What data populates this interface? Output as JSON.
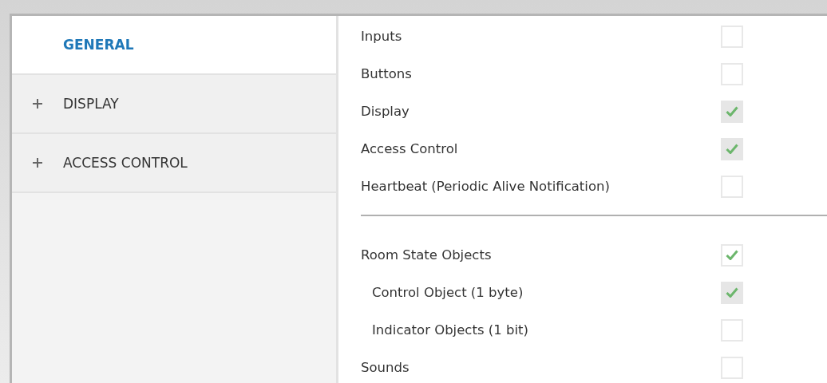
{
  "sidebar": {
    "items": [
      {
        "label": "GENERAL",
        "selected": true,
        "expandable": false
      },
      {
        "label": "DISPLAY",
        "selected": false,
        "expandable": true
      },
      {
        "label": "ACCESS CONTROL",
        "selected": false,
        "expandable": true
      }
    ]
  },
  "groups": [
    {
      "rows": [
        {
          "label": "Inputs",
          "checked": false,
          "disabled": false
        },
        {
          "label": "Buttons",
          "checked": false,
          "disabled": false
        },
        {
          "label": "Display",
          "checked": true,
          "disabled": true
        },
        {
          "label": "Access Control",
          "checked": true,
          "disabled": true
        },
        {
          "label": "Heartbeat (Periodic Alive Notification)",
          "checked": false,
          "disabled": false
        }
      ]
    },
    {
      "rows": [
        {
          "label": "Room State Objects",
          "checked": true,
          "disabled": false,
          "children": [
            {
              "label": "Control Object (1 byte)",
              "checked": true,
              "disabled": true
            },
            {
              "label": "Indicator Objects (1 bit)",
              "checked": false,
              "disabled": false
            }
          ]
        },
        {
          "label": "Sounds",
          "checked": false,
          "disabled": false
        }
      ]
    }
  ]
}
